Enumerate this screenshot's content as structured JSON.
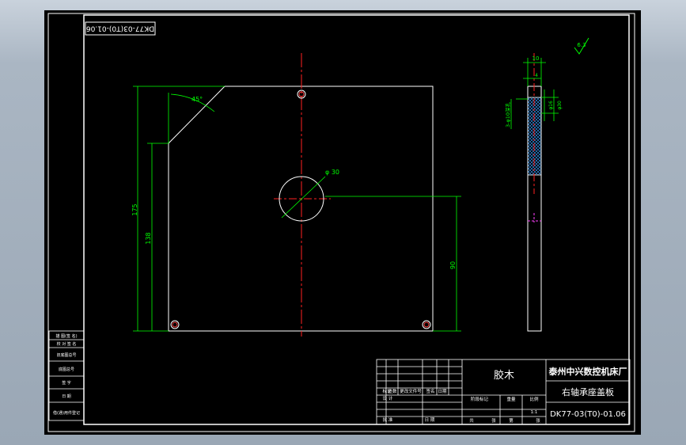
{
  "drawing": {
    "code_rotated": "DK77-03(T0)-01.06",
    "company": "泰州中兴数控机床厂",
    "part_name": "右轴承座盖板",
    "material": "胶木",
    "drawing_no": "DK77-03(T0)-01.06",
    "scale": "1:1",
    "roughness": "6.3"
  },
  "dimensions": {
    "angle": "45°",
    "diameter": "φ 30",
    "height_total": "175",
    "height_inner": "138",
    "offset_right": "90",
    "side_thickness": "10",
    "side_small": "4",
    "side_hole_label": "3-φ10深孔",
    "side_dim_a": "φ16",
    "side_dim_b": "φ30"
  },
  "left_table": {
    "rows": [
      "描 图(签 名)",
      "校 对 签 名",
      "旧底图总号",
      "底图总号",
      "签 字",
      "日 期",
      "借(通)用件登记"
    ]
  },
  "title_block": {
    "sign_labels": [
      "标记",
      "处数",
      "更改文件号",
      "签名",
      "日期"
    ],
    "row_design": [
      "设 计",
      "",
      "",
      ""
    ],
    "stage_headers": [
      "阶段标记",
      "重量",
      "比例"
    ],
    "bottom_cells": [
      "共",
      "张",
      "第",
      "张"
    ],
    "approve": "批 准",
    "date_label": "日 期"
  }
}
